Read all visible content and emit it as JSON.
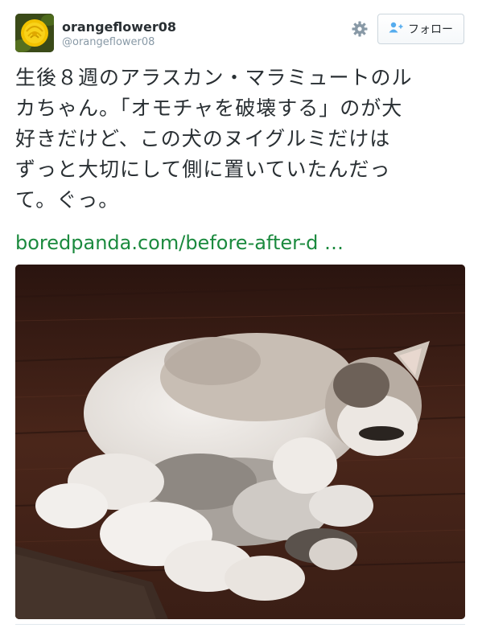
{
  "user": {
    "display_name": "orangeflower08",
    "handle": "@orangeflower08"
  },
  "header": {
    "settings_icon": "gear-icon",
    "follow_label": "フォロー",
    "follow_icon": "person-add-icon"
  },
  "tweet": {
    "text": "生後８週のアラスカン・マラミュートのル\nカちゃん。「オモチャを破壊する」のが大\n好きだけど、この犬のヌイグルミだけは\nずっと大切にして側に置いていたんだっ\nて。ぐっ。",
    "link_text": "boredpanda.com/before-after-d …"
  },
  "colors": {
    "link": "#1b8a3e",
    "handle": "#8899a6",
    "text": "#292f33"
  }
}
